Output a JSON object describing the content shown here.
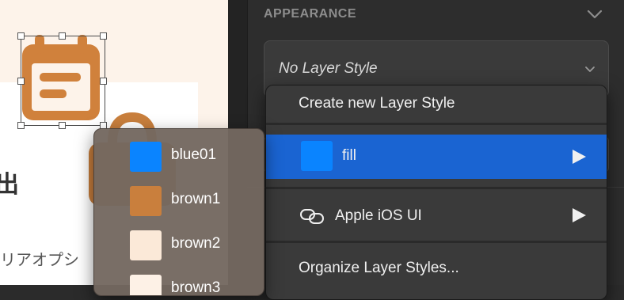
{
  "canvas": {
    "jp_char": "出",
    "jp_text": "リアオプシ"
  },
  "inspector": {
    "section_title": "APPEARANCE",
    "style_select_value": "No Layer Style"
  },
  "layer_style_menu": {
    "items": [
      {
        "label": "Create new Layer Style"
      },
      {
        "label": "fill",
        "swatch_color": "#0a84ff",
        "has_submenu": true
      },
      {
        "label": "Apple iOS UI",
        "icon": "link-icon",
        "has_submenu": true
      },
      {
        "label": "Organize Layer Styles..."
      }
    ]
  },
  "color_submenu": {
    "items": [
      {
        "label": "blue01",
        "color": "#0a84ff"
      },
      {
        "label": "brown1",
        "color": "#c97f3d"
      },
      {
        "label": "brown2",
        "color": "#fbe9d8"
      },
      {
        "label": "brown3",
        "color": "#fdf1e6"
      }
    ]
  },
  "colors": {
    "accent": "#1a64d2",
    "brand_orange": "#d0813c"
  }
}
